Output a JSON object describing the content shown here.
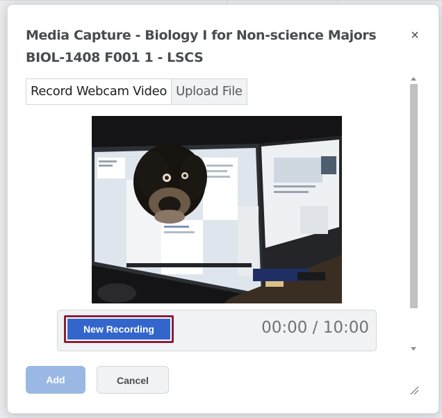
{
  "dialog": {
    "title": "Media Capture - Biology I for Non-science Majors BIOL-1408 F001 1 - LSCS",
    "close_icon": "close-icon",
    "close_symbol": "×"
  },
  "tabs": [
    {
      "label": "Record Webcam Video",
      "active": true
    },
    {
      "label": "Upload File",
      "active": false
    }
  ],
  "video": {
    "content": "webcam-preview-image"
  },
  "recorder": {
    "new_recording_label": "New Recording",
    "timer": "00:00 / 10:00"
  },
  "footer": {
    "add_label": "Add",
    "cancel_label": "Cancel",
    "resize_icon": "resize-grip-icon"
  },
  "colors": {
    "primary_button": "#3366cc",
    "primary_button_disabled": "#9bb8e4",
    "focus_border": "#8b1c3c",
    "title_text": "#494c4e"
  }
}
